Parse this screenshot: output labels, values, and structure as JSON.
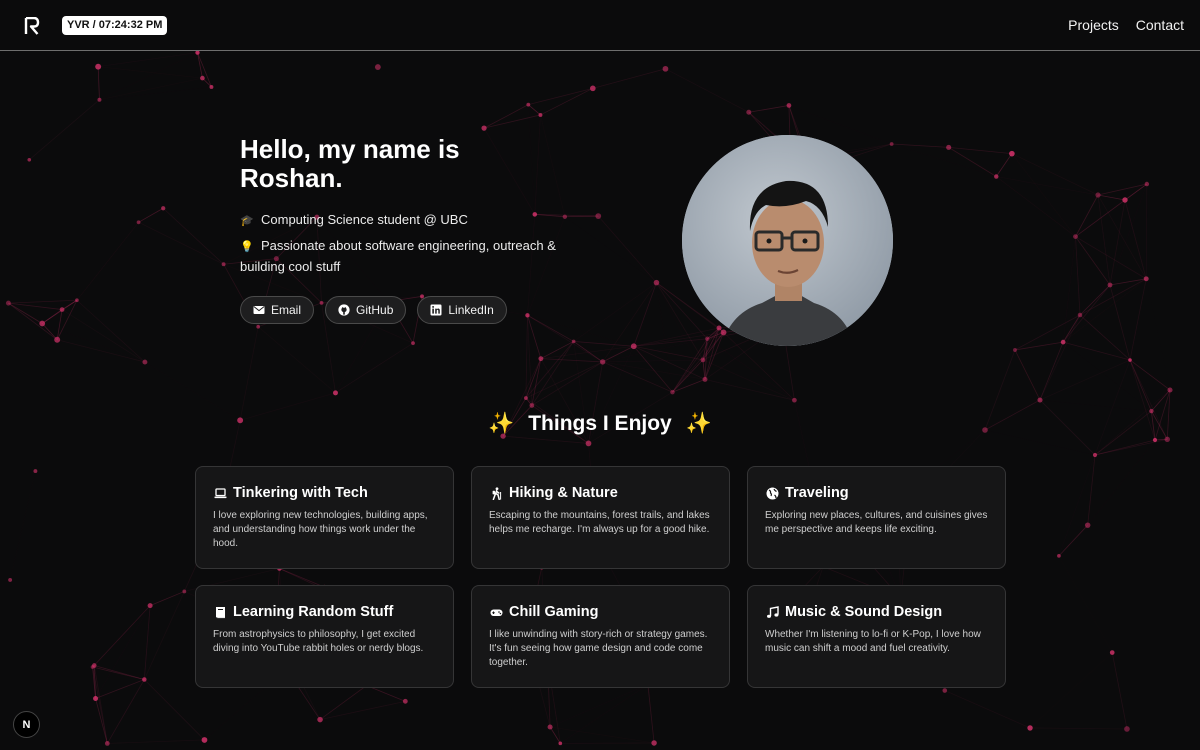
{
  "header": {
    "clock": "YVR / 07:24:32 PM",
    "nav": [
      {
        "label": "Projects"
      },
      {
        "label": "Contact"
      }
    ]
  },
  "hero": {
    "title": "Hello, my name is Roshan.",
    "bio": [
      {
        "icon": "graduation-cap-icon",
        "glyph": "🎓",
        "text": "Computing Science student @ UBC"
      },
      {
        "icon": "lightbulb-icon",
        "glyph": "💡",
        "text": "Passionate about software engineering, outreach & building cool stuff"
      }
    ],
    "socials": [
      {
        "label": "Email",
        "icon": "envelope-icon"
      },
      {
        "label": "GitHub",
        "icon": "github-icon"
      },
      {
        "label": "LinkedIn",
        "icon": "linkedin-icon"
      }
    ]
  },
  "section": {
    "title": "Things I Enjoy",
    "spark": "✨"
  },
  "cards": [
    {
      "title": "Tinkering with Tech",
      "icon": "laptop-icon",
      "desc": "I love exploring new technologies, building apps, and understanding how things work under the hood."
    },
    {
      "title": "Hiking & Nature",
      "icon": "hiker-icon",
      "desc": "Escaping to the mountains, forest trails, and lakes helps me recharge. I'm always up for a good hike."
    },
    {
      "title": "Traveling",
      "icon": "globe-icon",
      "desc": "Exploring new places, cultures, and cuisines gives me perspective and keeps life exciting."
    },
    {
      "title": "Learning Random Stuff",
      "icon": "book-icon",
      "desc": "From astrophysics to philosophy, I get excited diving into YouTube rabbit holes or nerdy blogs."
    },
    {
      "title": "Chill Gaming",
      "icon": "gamepad-icon",
      "desc": "I like unwinding with story-rich or strategy games. It's fun seeing how game design and code come together."
    },
    {
      "title": "Music & Sound Design",
      "icon": "music-note-icon",
      "desc": "Whether I'm listening to lo-fi or K-Pop, I love how music can shift a mood and fuel creativity."
    }
  ],
  "colors": {
    "background": "#0b0b0c",
    "accent_node": "#d6336c",
    "card_bg": "#161617"
  },
  "dev_badge": {
    "label": "N"
  }
}
